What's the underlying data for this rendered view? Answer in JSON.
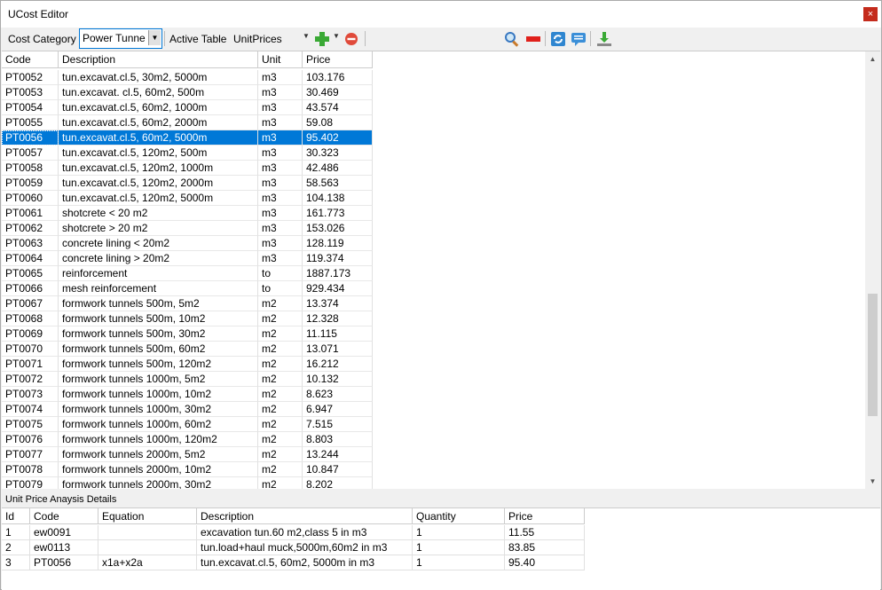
{
  "window": {
    "title": "UCost Editor",
    "close_glyph": "×"
  },
  "toolbar": {
    "cost_category_label": "Cost Category",
    "cost_category_value": "Power Tunne",
    "active_table_label": "Active Table",
    "active_table_value": "UnitPrices",
    "icons": [
      "add-icon",
      "remove-icon",
      "search-icon",
      "delete-icon",
      "refresh-icon",
      "comment-icon",
      "download-icon"
    ]
  },
  "grid": {
    "columns": [
      "Code",
      "Description",
      "Unit",
      "Price"
    ],
    "rows": [
      [
        "PT0052",
        "tun.excavat.cl.5, 30m2, 5000m",
        "m3",
        "103.176"
      ],
      [
        "PT0053",
        "tun.excavat. cl.5, 60m2, 500m",
        "m3",
        "30.469"
      ],
      [
        "PT0054",
        "tun.excavat.cl.5, 60m2, 1000m",
        "m3",
        "43.574"
      ],
      [
        "PT0055",
        "tun.excavat.cl.5, 60m2, 2000m",
        "m3",
        "59.08"
      ],
      [
        "PT0056",
        "tun.excavat.cl.5, 60m2, 5000m",
        "m3",
        "95.402"
      ],
      [
        "PT0057",
        "tun.excavat.cl.5, 120m2, 500m",
        "m3",
        "30.323"
      ],
      [
        "PT0058",
        "tun.excavat.cl.5, 120m2, 1000m",
        "m3",
        "42.486"
      ],
      [
        "PT0059",
        "tun.excavat.cl.5, 120m2, 2000m",
        "m3",
        "58.563"
      ],
      [
        "PT0060",
        "tun.excavat.cl.5, 120m2, 5000m",
        "m3",
        "104.138"
      ],
      [
        "PT0061",
        "shotcrete < 20 m2",
        "m3",
        "161.773"
      ],
      [
        "PT0062",
        "shotcrete > 20 m2",
        "m3",
        "153.026"
      ],
      [
        "PT0063",
        "concrete lining < 20m2",
        "m3",
        "128.119"
      ],
      [
        "PT0064",
        "concrete lining > 20m2",
        "m3",
        "119.374"
      ],
      [
        "PT0065",
        "reinforcement",
        "to",
        "1887.173"
      ],
      [
        "PT0066",
        "mesh reinforcement",
        "to",
        "929.434"
      ],
      [
        "PT0067",
        "formwork tunnels 500m, 5m2",
        "m2",
        "13.374"
      ],
      [
        "PT0068",
        "formwork tunnels 500m, 10m2",
        "m2",
        "12.328"
      ],
      [
        "PT0069",
        "formwork tunnels 500m, 30m2",
        "m2",
        "11.115"
      ],
      [
        "PT0070",
        "formwork tunnels 500m, 60m2",
        "m2",
        "13.071"
      ],
      [
        "PT0071",
        "formwork tunnels 500m, 120m2",
        "m2",
        "16.212"
      ],
      [
        "PT0072",
        "formwork tunnels 1000m, 5m2",
        "m2",
        "10.132"
      ],
      [
        "PT0073",
        "formwork tunnels 1000m, 10m2",
        "m2",
        "8.623"
      ],
      [
        "PT0074",
        "formwork tunnels 1000m, 30m2",
        "m2",
        "6.947"
      ],
      [
        "PT0075",
        "formwork tunnels 1000m, 60m2",
        "m2",
        "7.515"
      ],
      [
        "PT0076",
        "formwork tunnels 1000m, 120m2",
        "m2",
        "8.803"
      ],
      [
        "PT0077",
        "formwork tunnels 2000m, 5m2",
        "m2",
        "13.244"
      ],
      [
        "PT0078",
        "formwork tunnels 2000m, 10m2",
        "m2",
        "10.847"
      ],
      [
        "PT0079",
        "formwork tunnels 2000m, 30m2",
        "m2",
        "8.202"
      ]
    ],
    "selected_code": "PT0056"
  },
  "details": {
    "title": "Unit Price Anaysis Details",
    "columns": [
      "Id",
      "Code",
      "Equation",
      "Description",
      "Quantity",
      "Price"
    ],
    "rows": [
      [
        "1",
        "ew0091",
        "",
        "excavation tun.60 m2,class 5 in m3",
        "1",
        "11.55"
      ],
      [
        "2",
        "ew0113",
        "",
        "tun.load+haul muck,5000m,60m2 in m3",
        "1",
        "83.85"
      ],
      [
        "3",
        "PT0056",
        "x1a+x2a",
        "tun.excavat.cl.5, 60m2, 5000m in m3",
        "1",
        "95.40"
      ]
    ]
  },
  "colors": {
    "selection": "#0078d7",
    "accent_close": "#c42b1c"
  }
}
